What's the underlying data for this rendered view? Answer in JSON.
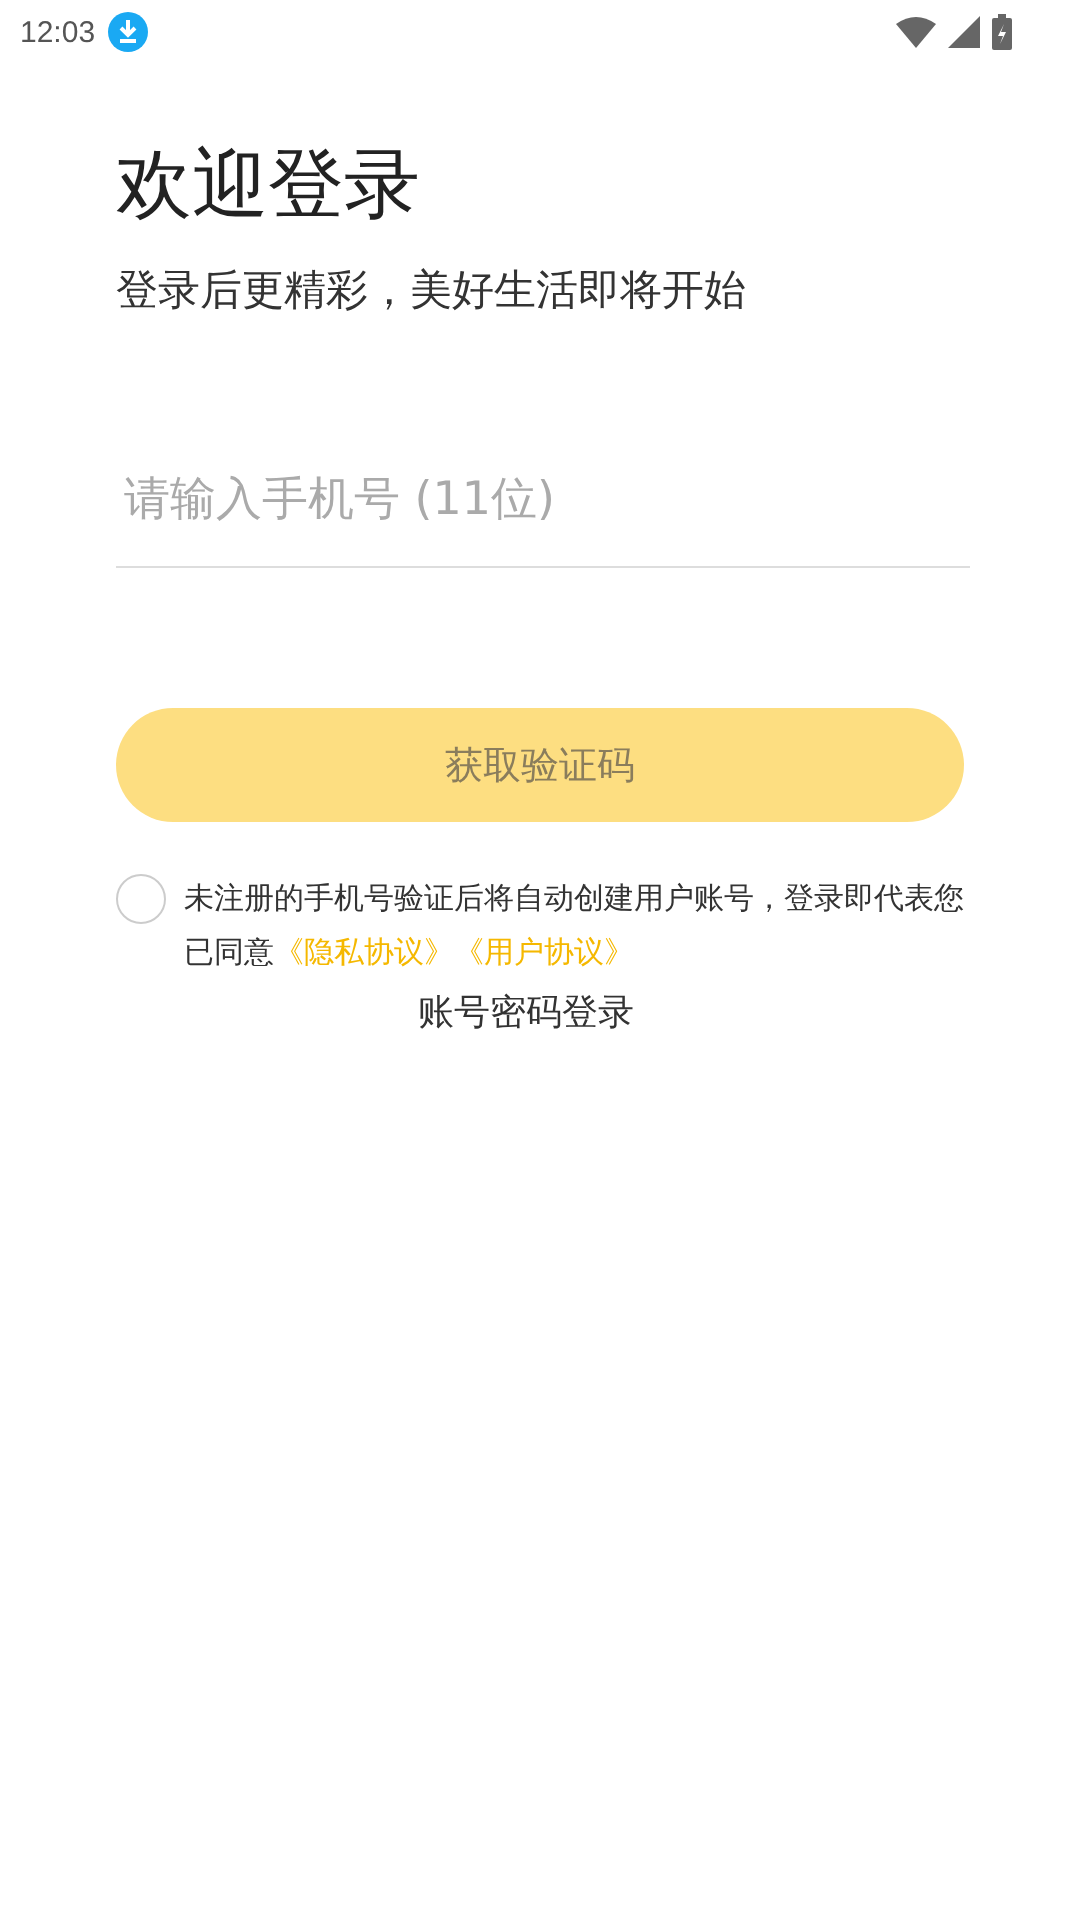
{
  "status_bar": {
    "time": "12:03"
  },
  "title": "欢迎登录",
  "subtitle": "登录后更精彩，美好生活即将开始",
  "phone_field": {
    "placeholder": "请输入手机号 (11位)"
  },
  "code_button": {
    "label": "获取验证码",
    "disabled": true
  },
  "agreement": {
    "checked": false,
    "text": "未注册的手机号验证后将自动创建用户账号，登录即代表您已同意",
    "links": [
      "《隐私协议》",
      "《用户协议》"
    ]
  },
  "password_login": "账号密码登录"
}
